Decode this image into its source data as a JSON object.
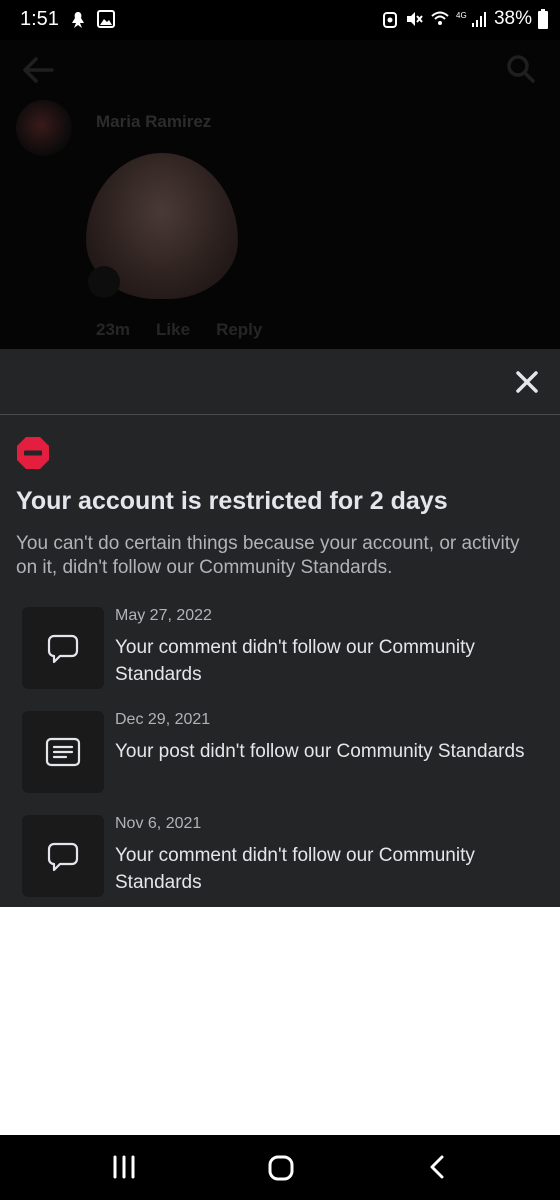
{
  "status_bar": {
    "time": "1:51",
    "battery": "38%"
  },
  "background": {
    "author_name": "Maria Ramirez",
    "comment_time": "23m",
    "like_label": "Like",
    "reply_label": "Reply"
  },
  "sheet": {
    "title": "Your account is restricted for 2 days",
    "description": "You can't do certain things because your account, or activity on it, didn't follow our Community Standards.",
    "close_icon": "close-icon",
    "violations": [
      {
        "date": "May 27, 2022",
        "text": "Your comment didn't follow our Community Standards",
        "icon": "comment-icon"
      },
      {
        "date": "Dec 29, 2021",
        "text": "Your post didn't follow our Community Standards",
        "icon": "post-icon"
      },
      {
        "date": "Nov 6, 2021",
        "text": "Your comment didn't follow our Community Standards",
        "icon": "comment-icon"
      }
    ]
  },
  "colors": {
    "sheet_bg": "#242526",
    "stop_red": "#e41e3f",
    "text_primary": "#e4e6eb",
    "text_secondary": "#b0b3b8"
  }
}
